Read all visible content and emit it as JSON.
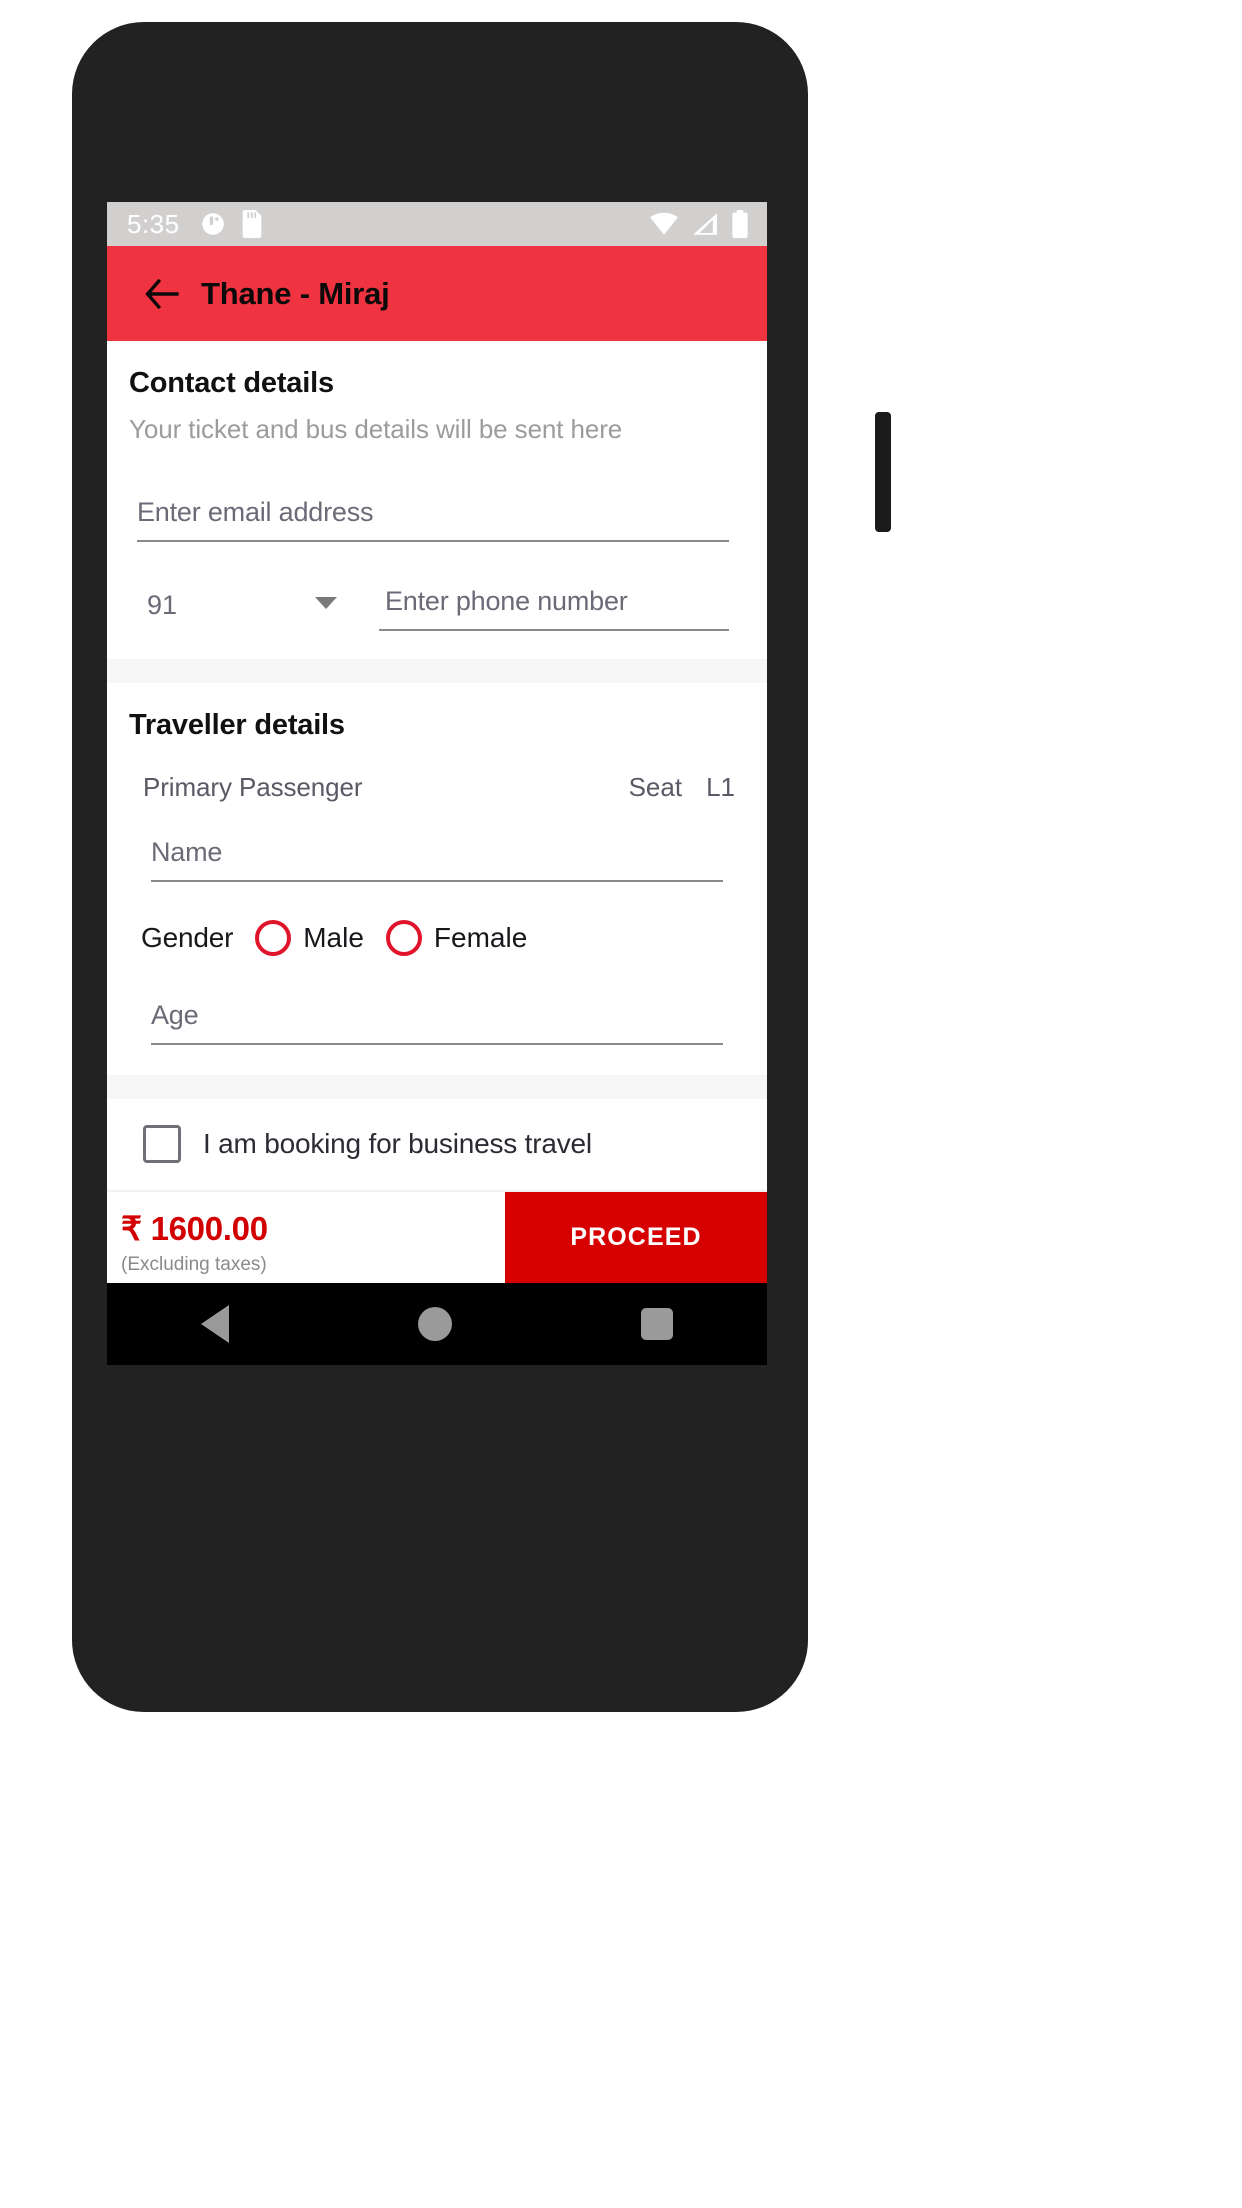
{
  "status_bar": {
    "time": "5:35",
    "icons_left": [
      "vibrate-icon",
      "sd-card-icon"
    ],
    "icons_right": [
      "wifi-icon",
      "signal-icon",
      "battery-icon"
    ]
  },
  "app_bar": {
    "back_icon": "back-arrow-icon",
    "title": "Thane - Miraj",
    "background": "#f03340"
  },
  "contact": {
    "title": "Contact details",
    "subtitle": "Your ticket and bus details will be sent here",
    "email_placeholder": "Enter email address",
    "email_value": "",
    "country_code": "91",
    "phone_placeholder": "Enter phone number",
    "phone_value": ""
  },
  "traveller": {
    "title": "Traveller details",
    "passenger_label": "Primary Passenger",
    "seat_label": "Seat",
    "seat_value": "L1",
    "name_placeholder": "Name",
    "name_value": "",
    "gender_label": "Gender",
    "gender_options": [
      "Male",
      "Female"
    ],
    "gender_selected": "",
    "age_placeholder": "Age",
    "age_value": ""
  },
  "business": {
    "checkbox_label": "I am booking for business travel",
    "checked": false
  },
  "bottom_bar": {
    "price": "₹ 1600.00",
    "price_note": "(Excluding taxes)",
    "proceed_label": "PROCEED",
    "proceed_color": "#d70000",
    "price_color": "#d20000"
  },
  "nav_bar": {
    "back": "nav-back-icon",
    "home": "nav-home-icon",
    "recent": "nav-recent-icon"
  }
}
